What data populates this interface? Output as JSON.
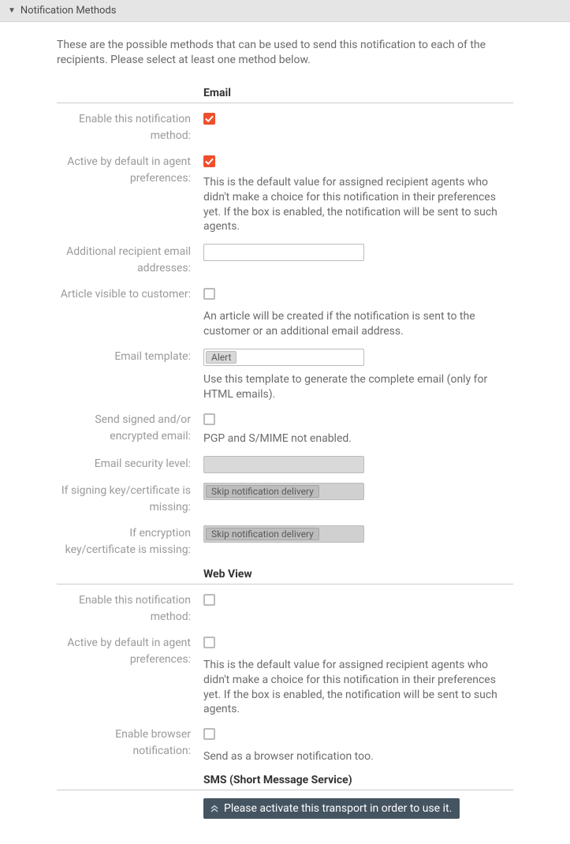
{
  "header": {
    "title": "Notification Methods"
  },
  "intro": "These are the possible methods that can be used to send this notification to each of the recipients. Please select at least one method below.",
  "email": {
    "section_title": "Email",
    "enable_label": "Enable this notification method:",
    "enable_checked": true,
    "active_default_label": "Active by default in agent preferences:",
    "active_default_checked": true,
    "active_default_help": "This is the default value for assigned recipient agents who didn't make a choice for this notification in their preferences yet. If the box is enabled, the notification will be sent to such agents.",
    "additional_recipient_label": "Additional recipient email addresses:",
    "additional_recipient_value": "",
    "article_visible_label": "Article visible to customer:",
    "article_visible_checked": false,
    "article_visible_help": "An article will be created if the notification is sent to the customer or an additional email address.",
    "email_template_label": "Email template:",
    "email_template_value": "Alert",
    "email_template_help": "Use this template to generate the complete email (only for HTML emails).",
    "signed_encrypted_label": "Send signed and/or encrypted email:",
    "signed_encrypted_checked": false,
    "signed_encrypted_help": "PGP and S/MIME not enabled.",
    "security_level_label": "Email security level:",
    "security_level_value": "",
    "signing_missing_label": "If signing key/certificate is missing:",
    "signing_missing_value": "Skip notification delivery",
    "encryption_missing_label": "If encryption key/certificate is missing:",
    "encryption_missing_value": "Skip notification delivery"
  },
  "webview": {
    "section_title": "Web View",
    "enable_label": "Enable this notification method:",
    "enable_checked": false,
    "active_default_label": "Active by default in agent preferences:",
    "active_default_checked": false,
    "active_default_help": "This is the default value for assigned recipient agents who didn't make a choice for this notification in their preferences yet. If the box is enabled, the notification will be sent to such agents.",
    "browser_notif_label": "Enable browser notification:",
    "browser_notif_checked": false,
    "browser_notif_help": "Send as a browser notification too."
  },
  "sms": {
    "section_title": "SMS (Short Message Service)",
    "banner": "Please activate this transport in order to use it."
  }
}
